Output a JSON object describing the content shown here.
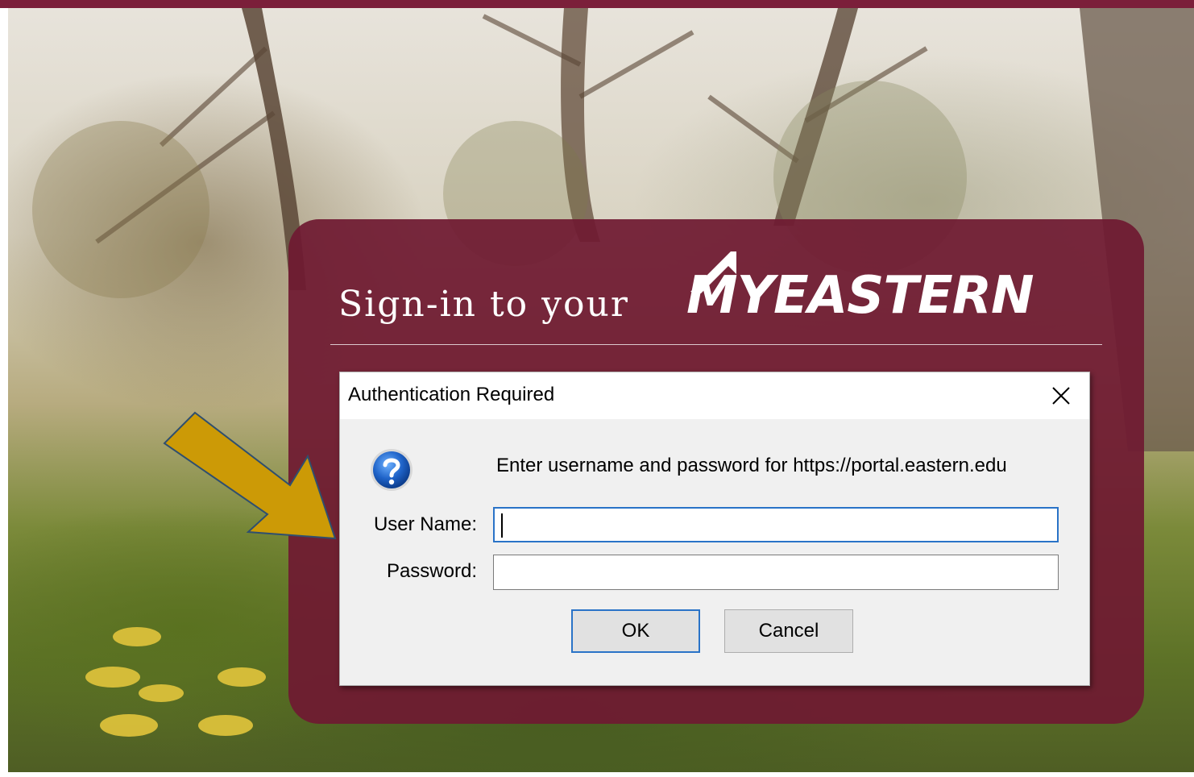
{
  "colors": {
    "brand_maroon": "#7b1f3a",
    "panel_maroon": "#6f1a32",
    "focus_blue": "#2a73c7",
    "arrow_gold": "#d4a017"
  },
  "page": {
    "heading": "Sign-in to your",
    "brand_logo_text": "MYEASTERN"
  },
  "dialog": {
    "title": "Authentication Required",
    "close_icon": "close-icon",
    "help_icon": "question-icon",
    "message": "Enter username and password for https://portal.eastern.edu",
    "username_label": "User Name:",
    "username_value": "",
    "password_label": "Password:",
    "password_value": "",
    "ok_label": "OK",
    "cancel_label": "Cancel"
  },
  "annotation": {
    "arrow_icon": "pointer-arrow-icon"
  }
}
